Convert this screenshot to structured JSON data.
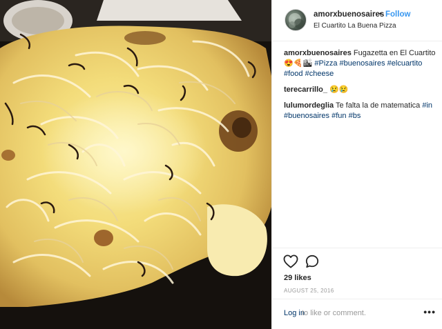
{
  "photo": {
    "alt_subject": "pizza-photo"
  },
  "post": {
    "username": "amorxbuenosaires",
    "separator": "•",
    "follow_label": "Follow",
    "location": "El Cuartito La Buena Pizza"
  },
  "comments": [
    {
      "author": "amorxbuenosaires",
      "text": "Fugazetta en El Cuartito 😍🍕🏙",
      "hashtags": [
        "#Pizza",
        "#buenosaires",
        "#elcuartito",
        "#food",
        "#cheese"
      ]
    },
    {
      "author": "terecarrillo_",
      "text": "😢😢",
      "hashtags": []
    },
    {
      "author": "lulumordeglia",
      "text": "Te falta la de matematica",
      "hashtags": [
        "#in",
        "#buenosaires",
        "#fun",
        "#bs"
      ]
    }
  ],
  "actions": {
    "like_icon": "heart-icon",
    "comment_icon": "comment-icon"
  },
  "likes_label": "29 likes",
  "date_label": "AUGUST 25, 2016",
  "login": {
    "link_label": "Log in",
    "rest_label": "to like or comment."
  },
  "more_label": "•••",
  "colors": {
    "link_blue": "#3897f0",
    "hashtag": "#003569",
    "muted": "#999999"
  }
}
